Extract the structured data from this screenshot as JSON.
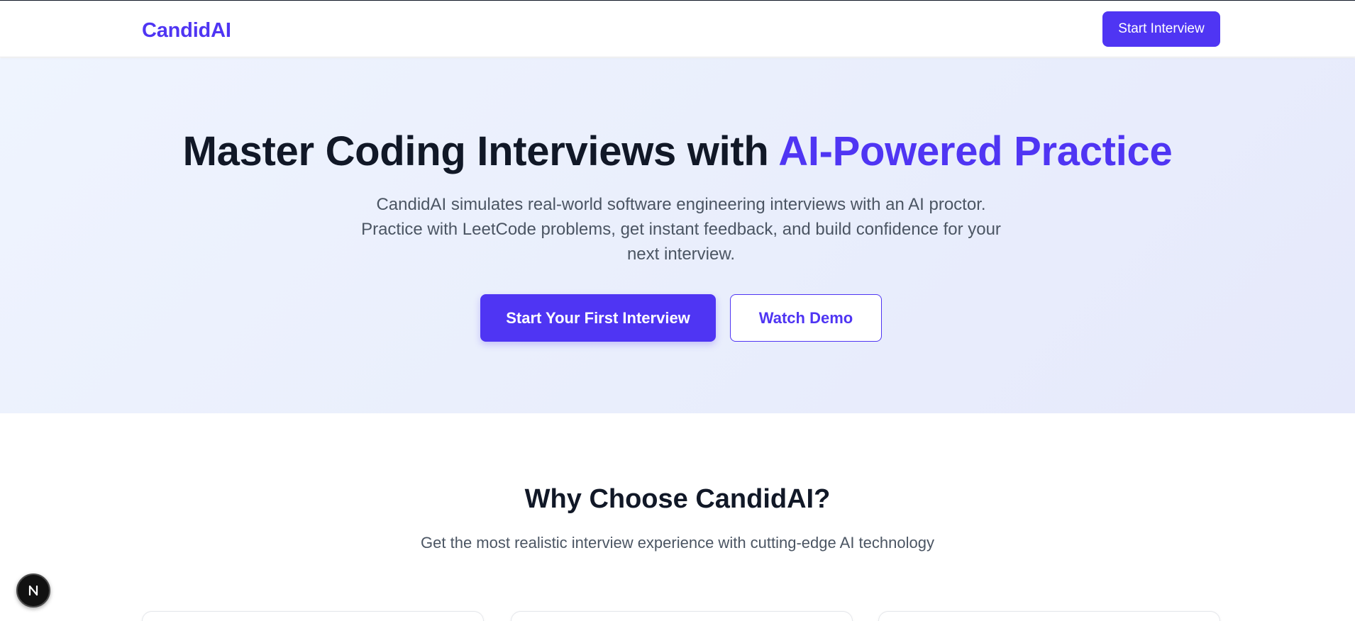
{
  "nav": {
    "logo": "CandidAI",
    "cta_label": "Start Interview"
  },
  "hero": {
    "title_prefix": "Master Coding Interviews with ",
    "title_accent": "AI-Powered Practice",
    "subtitle_lines": [
      "CandidAI simulates real-world software engineering interviews with an AI proctor.",
      "Practice with LeetCode problems, get instant feedback, and build confidence for your",
      "next interview."
    ],
    "primary_button": "Start Your First Interview",
    "secondary_button": "Watch Demo"
  },
  "features": {
    "title": "Why Choose CandidAI?",
    "subtitle": "Get the most realistic interview experience with cutting-edge AI technology"
  },
  "dev_indicator": {
    "icon": "nextjs-icon",
    "letter": "N"
  },
  "colors": {
    "brand": "#4f35f3",
    "heading": "#111827",
    "body_text": "#4b5563",
    "hero_bg": "#eaeffd"
  }
}
